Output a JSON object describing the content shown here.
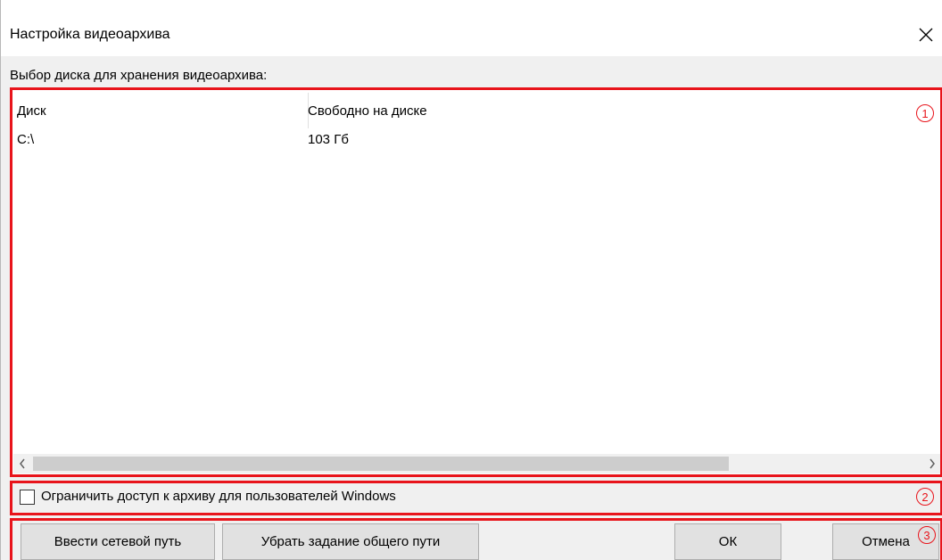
{
  "window": {
    "title": "Настройка видеоархива"
  },
  "disk_section": {
    "label": "Выбор диска для хранения видеоархива:",
    "columns": [
      "Диск",
      "Свободно на диске"
    ],
    "rows": [
      {
        "disk": "C:\\",
        "free": "103 Гб"
      }
    ]
  },
  "restrict_access": {
    "label": "Ограничить доступ к архиву для пользователей Windows",
    "checked": false
  },
  "buttons": {
    "network_path": "Ввести сетевой путь",
    "remove_shared_path": "Убрать задание общего пути",
    "ok": "ОК",
    "cancel": "Отмена"
  },
  "annotations": {
    "one": "1",
    "two": "2",
    "three": "3",
    "color": "#e8141b"
  },
  "icons": {
    "close": "close-icon",
    "scroll_left": "chevron-left-icon",
    "scroll_right": "chevron-right-icon"
  }
}
